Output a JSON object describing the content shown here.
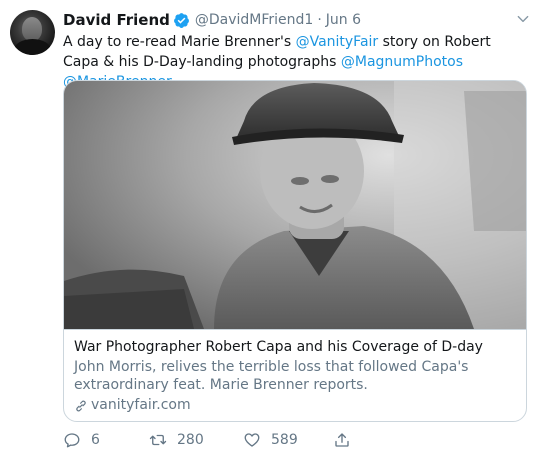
{
  "author": {
    "name": "David Friend",
    "handle": "@DavidMFriend1",
    "separator": "·",
    "date": "Jun 6"
  },
  "tweet": {
    "text_1": "A day to re-read Marie Brenner's ",
    "mention_1": "@VanityFair",
    "text_2": " story on Robert Capa & his D-Day-landing photographs ",
    "mention_2": "@MagnumPhotos",
    "text_3": " ",
    "mention_3": "@MarieBrenner"
  },
  "card": {
    "title": "War Photographer Robert Capa and his Coverage of D-day",
    "description": "John Morris, relives the terrible loss that followed Capa's extraordinary feat. Marie Brenner reports.",
    "domain": "vanityfair.com"
  },
  "actions": {
    "replies": "6",
    "retweets": "280",
    "likes": "589"
  },
  "colors": {
    "link": "#1b95e0",
    "secondary_text": "#657786",
    "border": "#ccd6dd"
  },
  "icons": [
    "verified-badge-icon",
    "chevron-down-icon",
    "link-icon",
    "reply-icon",
    "retweet-icon",
    "heart-icon",
    "share-icon"
  ]
}
